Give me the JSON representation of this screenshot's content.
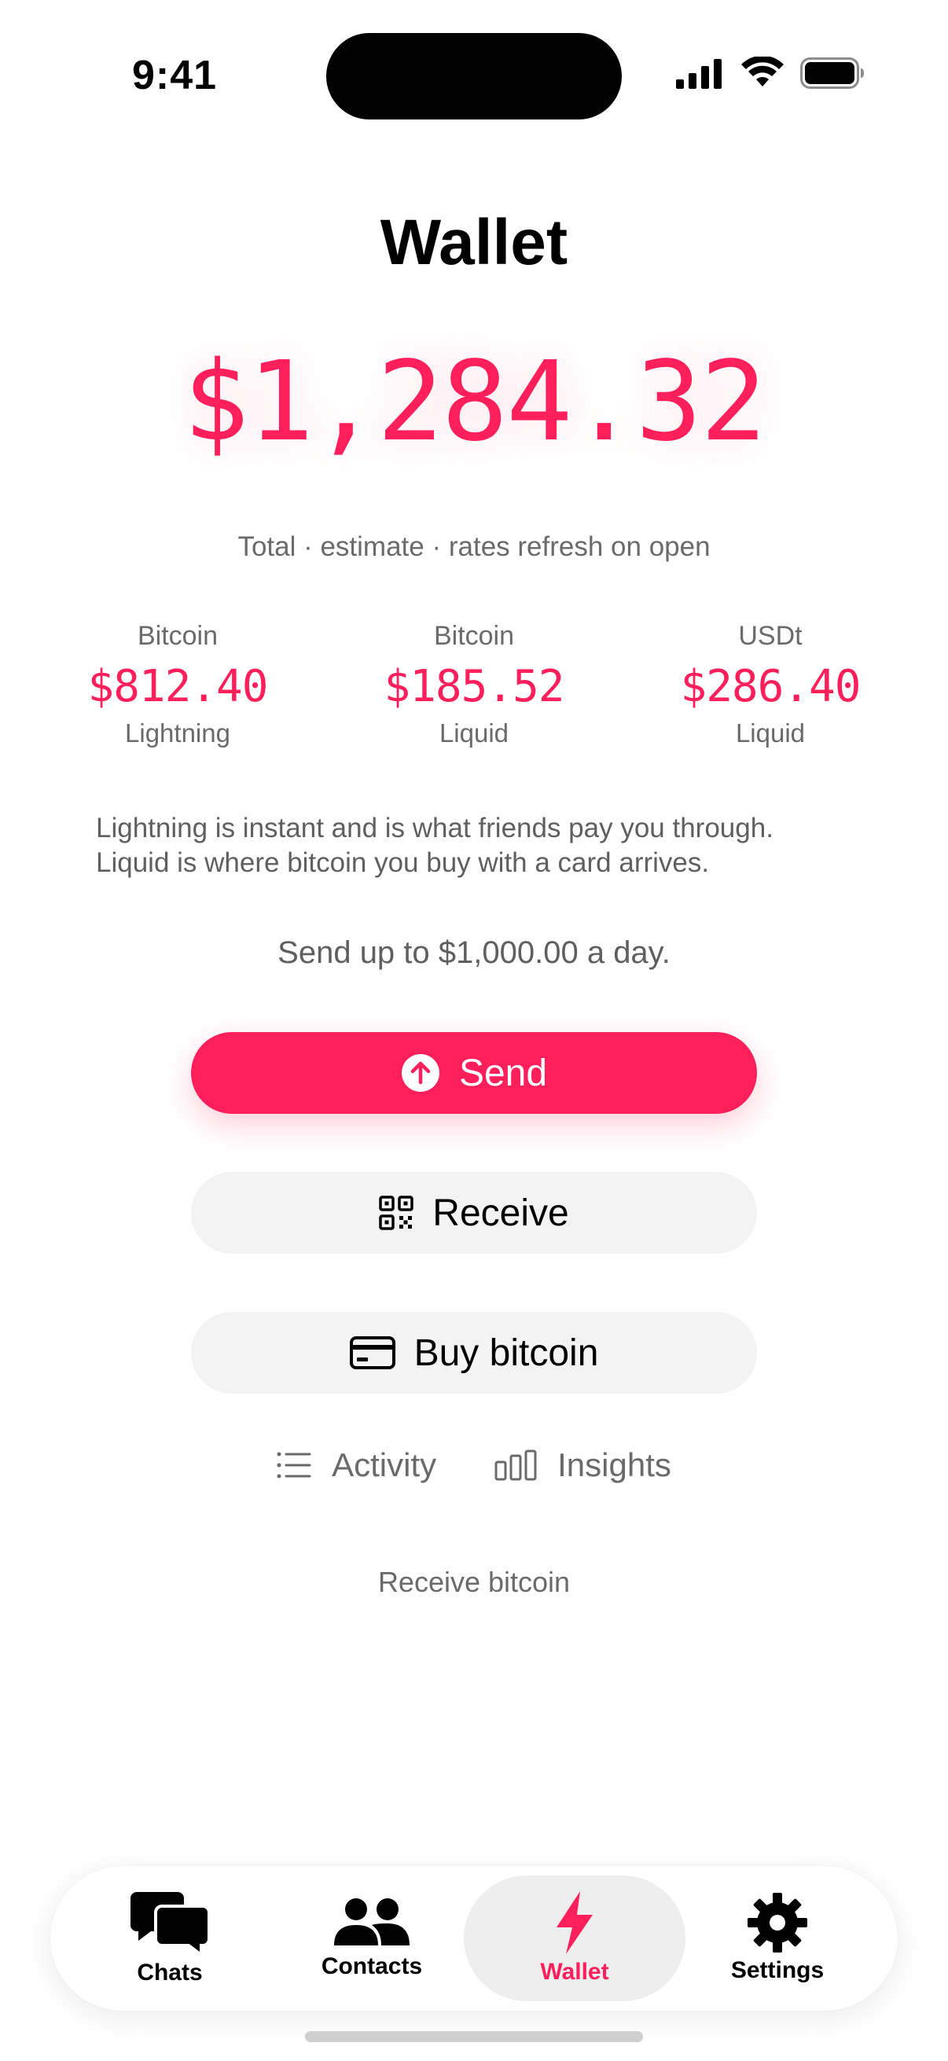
{
  "status_bar": {
    "time": "9:41"
  },
  "header": {
    "title": "Wallet"
  },
  "balance": {
    "total": "$1,284.32",
    "note": "Total · estimate · rates refresh on open"
  },
  "breakdown": [
    {
      "asset": "Bitcoin",
      "amount": "$812.40",
      "network": "Lightning"
    },
    {
      "asset": "Bitcoin",
      "amount": "$185.52",
      "network": "Liquid"
    },
    {
      "asset": "USDt",
      "amount": "$286.40",
      "network": "Liquid"
    }
  ],
  "explanation": {
    "line1": "Lightning is instant and is what friends pay you through.",
    "line2": "Liquid is where bitcoin you buy with a card arrives."
  },
  "limit_text": "Send up to $1,000.00 a day.",
  "actions": {
    "send_label": "Send",
    "receive_label": "Receive",
    "buy_label": "Buy bitcoin"
  },
  "links": {
    "activity_label": "Activity",
    "insights_label": "Insights"
  },
  "receive_bitcoin_label": "Receive bitcoin",
  "tabs": [
    {
      "label": "Chats",
      "icon": "chat-bubbles-icon"
    },
    {
      "label": "Contacts",
      "icon": "people-icon"
    },
    {
      "label": "Wallet",
      "icon": "lightning-bolt-icon",
      "active": true
    },
    {
      "label": "Settings",
      "icon": "gear-icon"
    }
  ],
  "colors": {
    "accent": "#ff1f5b",
    "secondary_button_bg": "#f3f3f3",
    "muted_text": "#6a6a6a"
  }
}
